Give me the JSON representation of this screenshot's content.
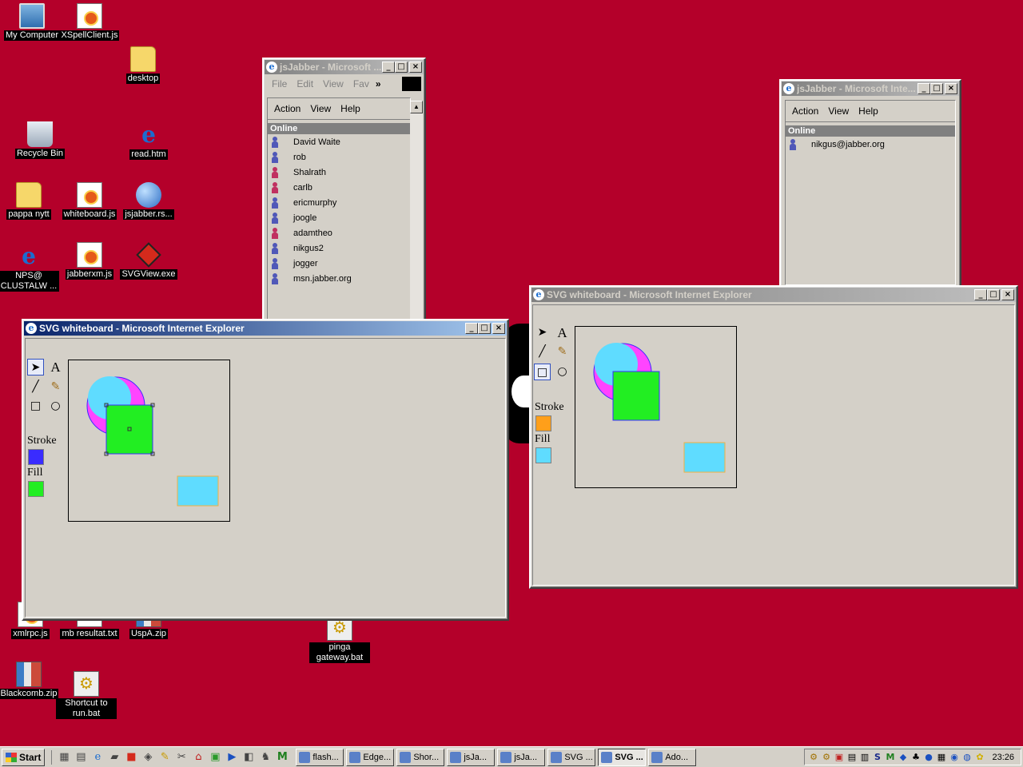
{
  "desktop": {
    "icons": [
      {
        "label": "My Computer"
      },
      {
        "label": "XSpellClient.js"
      },
      {
        "label": "desktop"
      },
      {
        "label": "Recycle Bin"
      },
      {
        "label": "read.htm"
      },
      {
        "label": "pappa nytt"
      },
      {
        "label": "whiteboard.js"
      },
      {
        "label": "jsjabber.rs..."
      },
      {
        "label": "NPS@ CLUSTALW ..."
      },
      {
        "label": "jabberxm.js"
      },
      {
        "label": "SVGView.exe"
      },
      {
        "label": "xmlrpc.js"
      },
      {
        "label": "mb resultat.txt"
      },
      {
        "label": "UspA.zip"
      },
      {
        "label": "pinga gateway.bat"
      },
      {
        "label": "Blackcomb.zip"
      },
      {
        "label": "Shortcut to run.bat"
      }
    ],
    "background_color": "#b4002a"
  },
  "jabber_left": {
    "title": "jsJabber - Microsoft ...",
    "ie_menu": [
      "File",
      "Edit",
      "View",
      "Fav"
    ],
    "app_menu": [
      "Action",
      "View",
      "Help"
    ],
    "group": "Online",
    "contacts": [
      {
        "name": "David Waite",
        "status": "online"
      },
      {
        "name": "rob",
        "status": "online"
      },
      {
        "name": "Shalrath",
        "status": "away"
      },
      {
        "name": "carlb",
        "status": "away"
      },
      {
        "name": "ericmurphy",
        "status": "online"
      },
      {
        "name": "joogle",
        "status": "online"
      },
      {
        "name": "adamtheo",
        "status": "away"
      },
      {
        "name": "nikgus2",
        "status": "online"
      },
      {
        "name": "jogger",
        "status": "online"
      },
      {
        "name": "msn.jabber.org",
        "status": "online"
      }
    ]
  },
  "jabber_right": {
    "title": "jsJabber - Microsoft Inte...",
    "app_menu": [
      "Action",
      "View",
      "Help"
    ],
    "group": "Online",
    "contacts": [
      {
        "name": "nikgus@jabber.org",
        "status": "online"
      }
    ]
  },
  "whiteboard_left": {
    "title": "SVG whiteboard - Microsoft Internet Explorer",
    "stroke_label": "Stroke",
    "fill_label": "Fill",
    "stroke_color": "#3a2cff",
    "fill_color": "#22ee22",
    "selected_tool": "pointer"
  },
  "whiteboard_right": {
    "title": "SVG whiteboard - Microsoft Internet Explorer",
    "stroke_label": "Stroke",
    "fill_label": "Fill",
    "stroke_color": "#ff9f1a",
    "fill_color": "#5fdcff",
    "selected_tool": "rectangle"
  },
  "window_buttons": {
    "minimize": "_",
    "maximize": "□",
    "close": "×"
  },
  "taskbar": {
    "start_label": "Start",
    "tasks": [
      {
        "label": "flash...",
        "pressed": false
      },
      {
        "label": "Edge...",
        "pressed": false
      },
      {
        "label": "Shor...",
        "pressed": false
      },
      {
        "label": "jsJa...",
        "pressed": false
      },
      {
        "label": "jsJa...",
        "pressed": false
      },
      {
        "label": "SVG ...",
        "pressed": false
      },
      {
        "label": "SVG ...",
        "pressed": true
      },
      {
        "label": "Ado...",
        "pressed": false
      }
    ],
    "clock": "23:26"
  }
}
